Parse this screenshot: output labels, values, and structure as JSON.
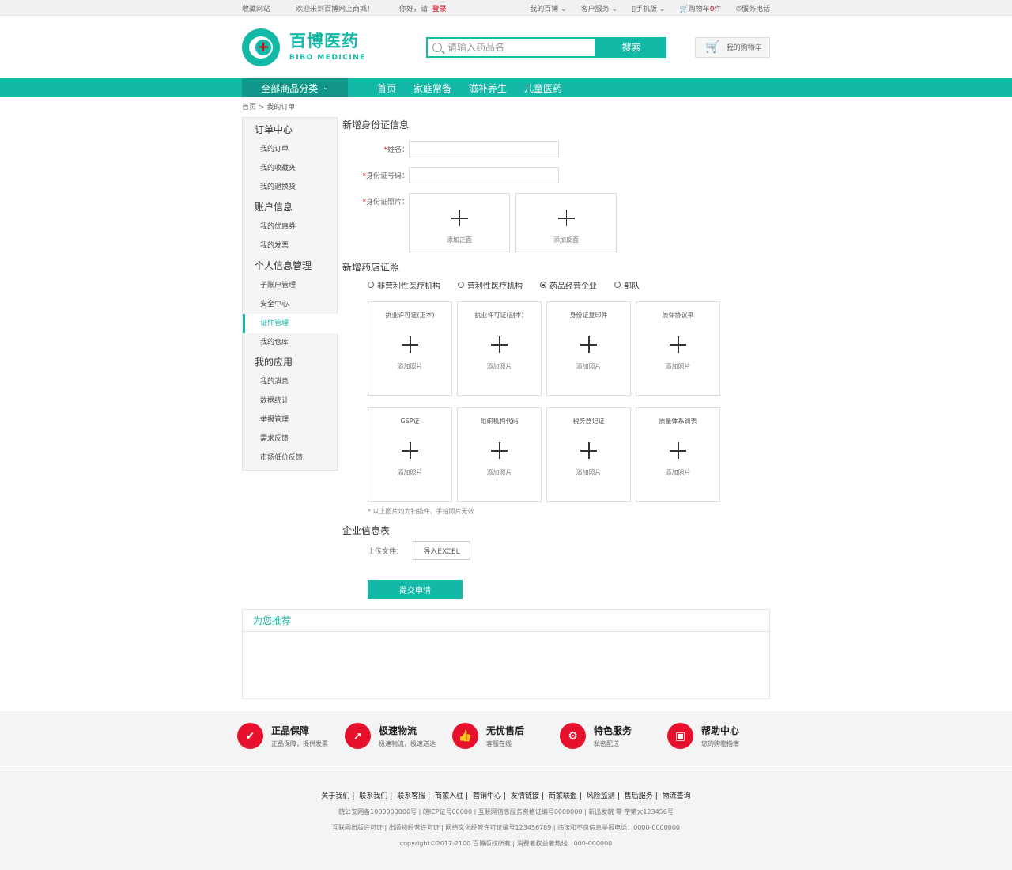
{
  "topbar": {
    "favorite": "收藏网站",
    "welcome": "欢迎来到百博网上商城！",
    "greeting": "你好，请",
    "login": "登录",
    "my_bibo": "我的百博 ⌄",
    "customer_service": "客户服务 ⌄",
    "mobile": "手机版 ⌄",
    "cart_prefix": "购物车",
    "cart_count": "0",
    "cart_suffix": "件",
    "phone": "服务电话"
  },
  "header": {
    "logo_cn": "百博医药",
    "logo_en": "BIBO MEDICINE",
    "search_placeholder": "请输入药品名",
    "search_button": "搜索",
    "cart_button": "我的购物车"
  },
  "nav": {
    "all_categories": "全部商品分类",
    "links": [
      "首页",
      "家庭常备",
      "滋补养生",
      "儿童医药"
    ]
  },
  "breadcrumb": "首页 > 我的订单",
  "sidebar": {
    "groups": [
      {
        "title": "订单中心",
        "items": [
          "我的订单",
          "我的收藏夹",
          "我的退换货"
        ]
      },
      {
        "title": "账户信息",
        "items": [
          "我的优惠券",
          "我的发票"
        ]
      },
      {
        "title": "个人信息管理",
        "items": [
          "子账户管理",
          "安全中心",
          "证件管理",
          "我的仓库"
        ]
      },
      {
        "title": "我的应用",
        "items": [
          "我的消息",
          "数据统计",
          "举报管理",
          "需求反馈",
          "市场低价反馈"
        ]
      }
    ],
    "active_item": "证件管理"
  },
  "id_section": {
    "title": "新增身份证信息",
    "name_label": "姓名：",
    "id_number_label": "身份证号码：",
    "photo_label": "身份证照片：",
    "required_mark": "*",
    "front_label": "添加正面",
    "back_label": "添加反面"
  },
  "license_section": {
    "title": "新增药店证照",
    "radios": [
      {
        "label": "非营利性医疗机构",
        "checked": false
      },
      {
        "label": "营利性医疗机构",
        "checked": false
      },
      {
        "label": "药品经营企业",
        "checked": true
      },
      {
        "label": "部队",
        "checked": false
      }
    ],
    "uploads": [
      "执业许可证(正本)",
      "执业许可证(副本)",
      "身份证复印件",
      "质保协议书",
      "GSP证",
      "组织机构代码",
      "税务登记证",
      "质量体系调表"
    ],
    "add_photo": "添加照片",
    "note": "* 以上图片均为扫描件，手拍照片无效"
  },
  "enterprise_section": {
    "title": "企业信息表",
    "upload_label": "上传文件：",
    "import_button": "导入EXCEL",
    "submit_button": "提交申请"
  },
  "recommend": {
    "title": "为您推荐"
  },
  "services": [
    {
      "title": "正品保障",
      "sub": "正品保障，提供发票",
      "icon": "shield-icon"
    },
    {
      "title": "极速物流",
      "sub": "极速物流，极速送达",
      "icon": "rocket-icon"
    },
    {
      "title": "无忧售后",
      "sub": "客服在线",
      "icon": "thumbs-up-icon"
    },
    {
      "title": "特色服务",
      "sub": "私密配送",
      "icon": "gears-icon"
    },
    {
      "title": "帮助中心",
      "sub": "您的购物指南",
      "icon": "book-icon"
    }
  ],
  "footer": {
    "links": [
      "关于我们",
      "联系我们",
      "联系客服",
      "商家入驻",
      "营销中心",
      "友情链接",
      "商家联盟",
      "风险监测",
      "售后服务",
      "物流查询"
    ],
    "line1": "皖公安网备1000000000号 | 皖ICP证号00000 | 互联网信息服务资格证编号0000000 | 新出发皖 零 字第大123456号",
    "line2": "互联网出版许可证 | 出版物经营许可证 | 网络文化经营许可证编号123456789 | 违法和不良信息举报电话：0000-0000000",
    "line3": "copyright©2017-2100 百博版权所有 | 消费者权益者热线：000-000000"
  },
  "colors": {
    "accent": "#14b8a6",
    "accent_dark": "#0f9688",
    "service_red": "#e8112d"
  }
}
